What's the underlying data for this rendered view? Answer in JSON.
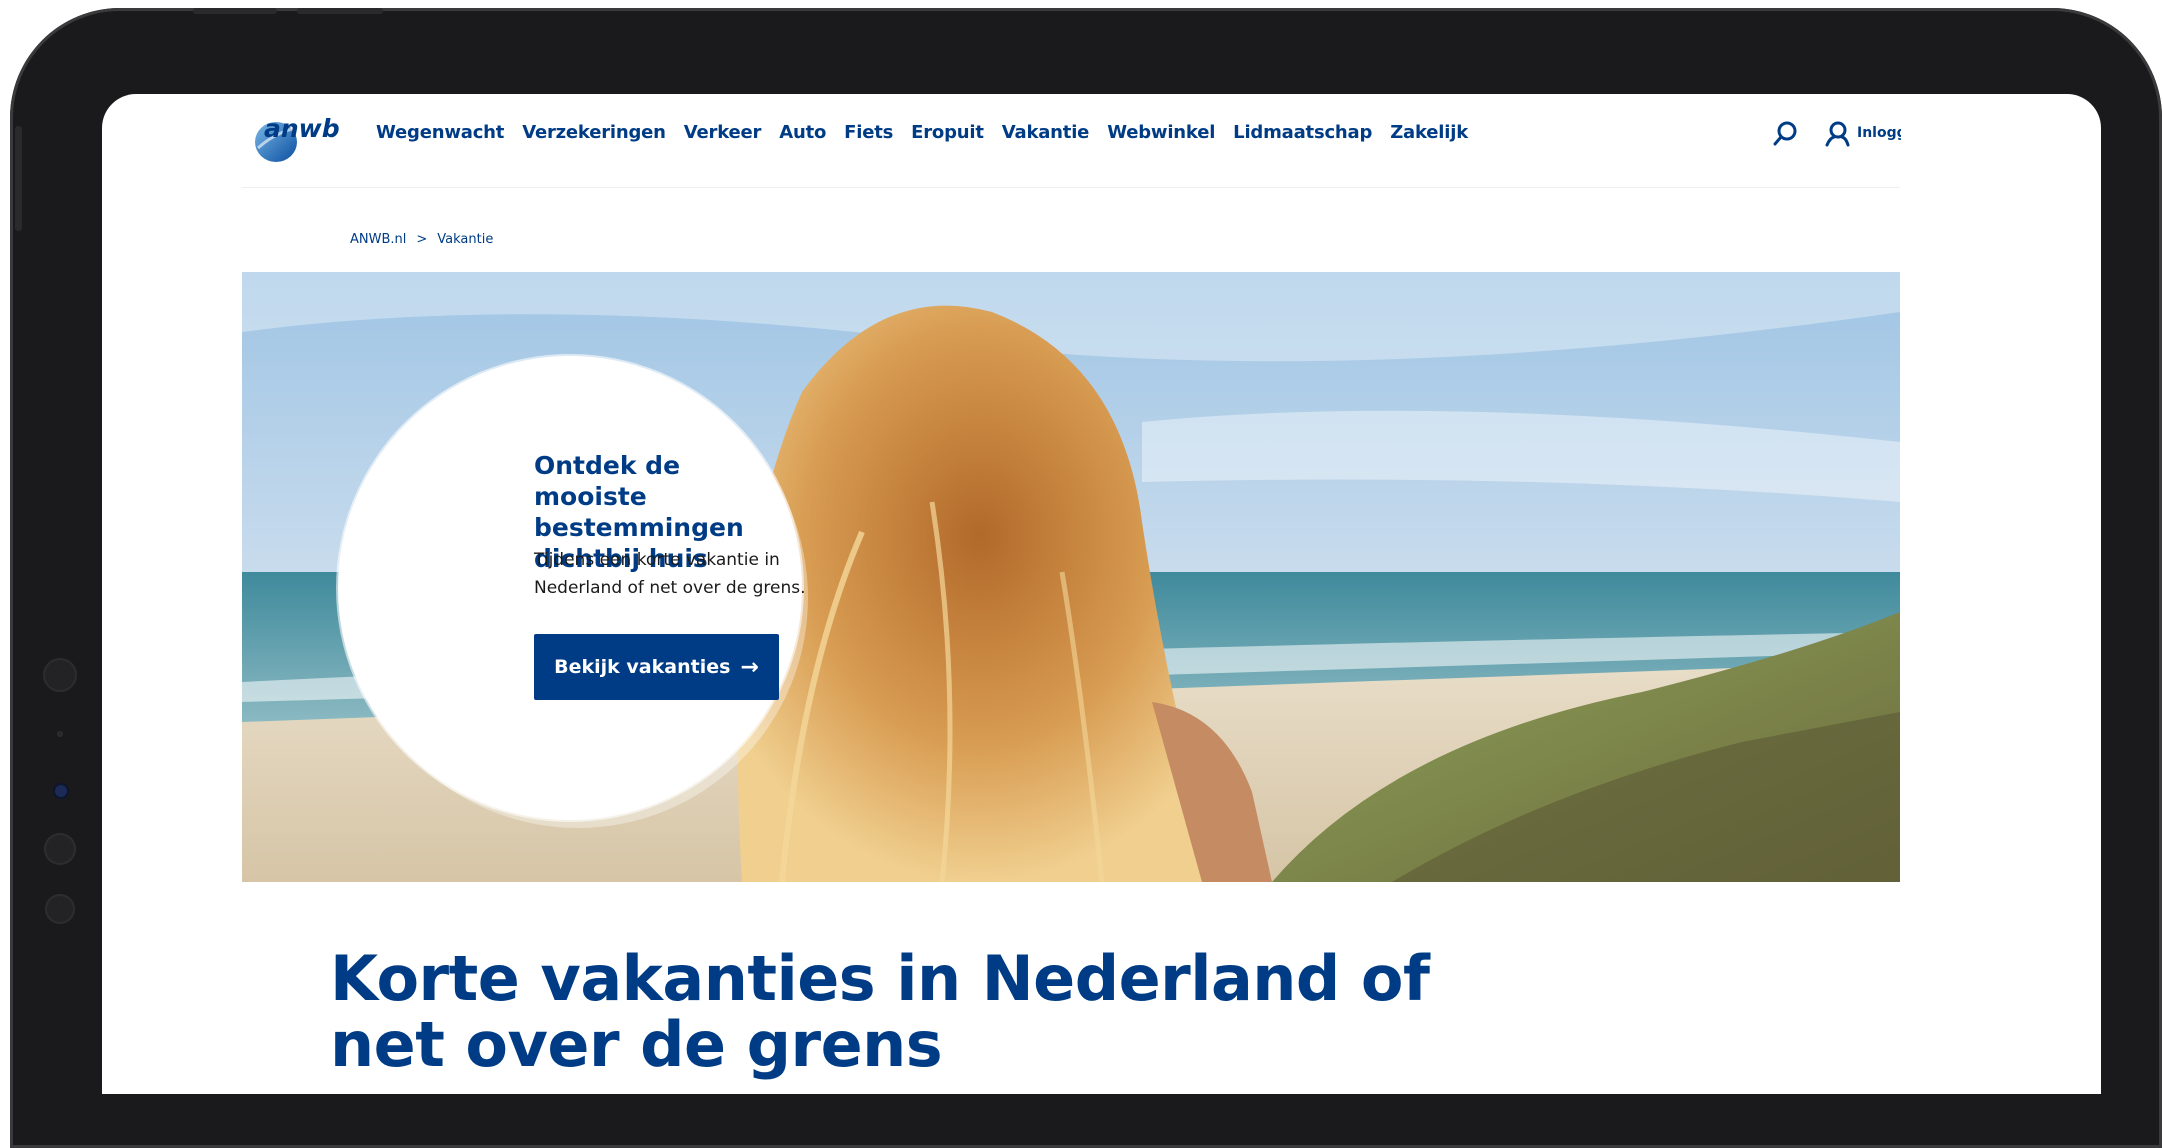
{
  "header": {
    "logo_text": "anwb",
    "nav": [
      {
        "label": "Wegenwacht"
      },
      {
        "label": "Verzekeringen"
      },
      {
        "label": "Verkeer"
      },
      {
        "label": "Auto"
      },
      {
        "label": "Fiets"
      },
      {
        "label": "Eropuit"
      },
      {
        "label": "Vakantie"
      },
      {
        "label": "Webwinkel"
      },
      {
        "label": "Lidmaatschap"
      },
      {
        "label": "Zakelijk"
      }
    ],
    "login_label": "Inlogg",
    "search_icon": "search-icon",
    "user_icon": "user-icon"
  },
  "breadcrumb": {
    "home": "ANWB.nl",
    "separator": ">",
    "current": "Vakantie"
  },
  "hero": {
    "title": "Ontdek de mooiste bestemmingen dichtbij huis",
    "text": "Tijdens een korte vakantie in Nederland of net over de grens.",
    "button_label": "Bekijk vakanties",
    "button_icon": "arrow-right-icon"
  },
  "main": {
    "title": "Korte vakanties in Nederland of net over de grens"
  },
  "colors": {
    "brand_blue": "#003c85",
    "frame": "#1a1a1c"
  }
}
